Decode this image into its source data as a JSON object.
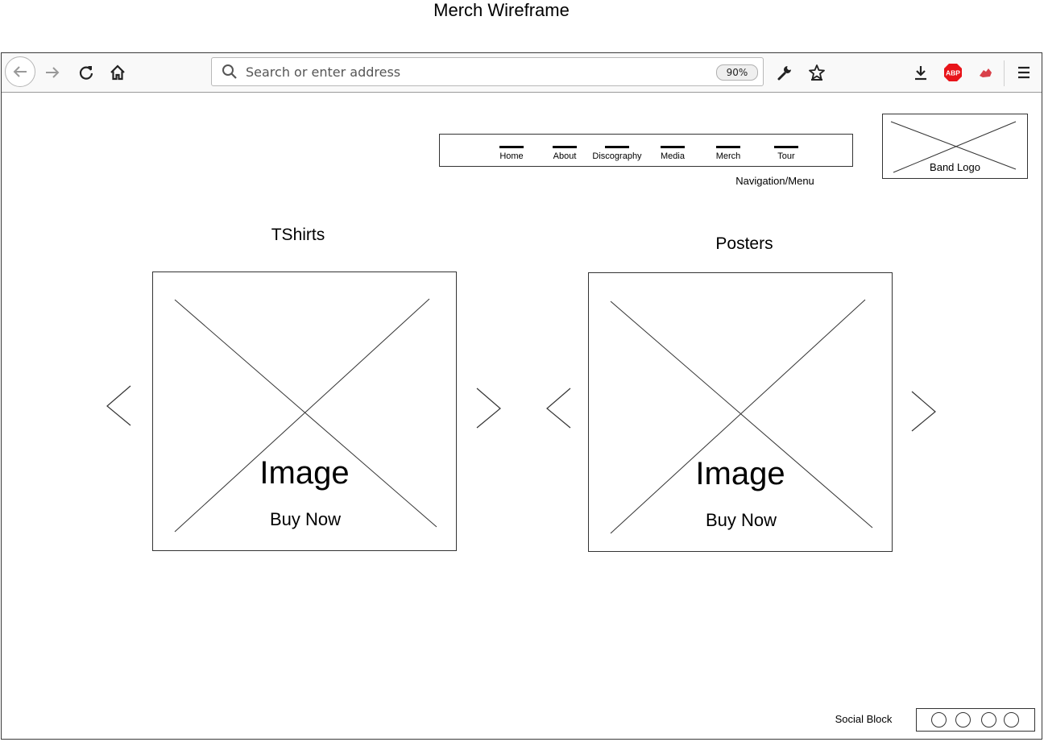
{
  "page_title": "Merch Wireframe",
  "browser": {
    "address_placeholder": "Search or enter address",
    "zoom_level": "90%",
    "icons": [
      "back-arrow-icon",
      "forward-arrow-icon",
      "reload-icon",
      "home-icon",
      "search-icon",
      "wrench-icon",
      "bookmark-star-icon",
      "download-icon",
      "adblock-plus-icon",
      "extension-icon",
      "hamburger-menu-icon"
    ],
    "abp_badge_text": "ABP",
    "abp_color": "#e8141a",
    "extension_color": "#d9414a"
  },
  "nav": {
    "items": [
      {
        "label": "Home"
      },
      {
        "label": "About"
      },
      {
        "label": "Discography"
      },
      {
        "label": "Media"
      },
      {
        "label": "Merch"
      },
      {
        "label": "Tour"
      }
    ],
    "caption": "Navigation/Menu"
  },
  "logo": {
    "label": "Band Logo"
  },
  "sections": {
    "tshirts": {
      "title": "TShirts",
      "image_label": "Image",
      "buy_label": "Buy Now"
    },
    "posters": {
      "title": "Posters",
      "image_label": "Image",
      "buy_label": "Buy Now"
    }
  },
  "social": {
    "label": "Social Block",
    "circle_count": 4
  }
}
